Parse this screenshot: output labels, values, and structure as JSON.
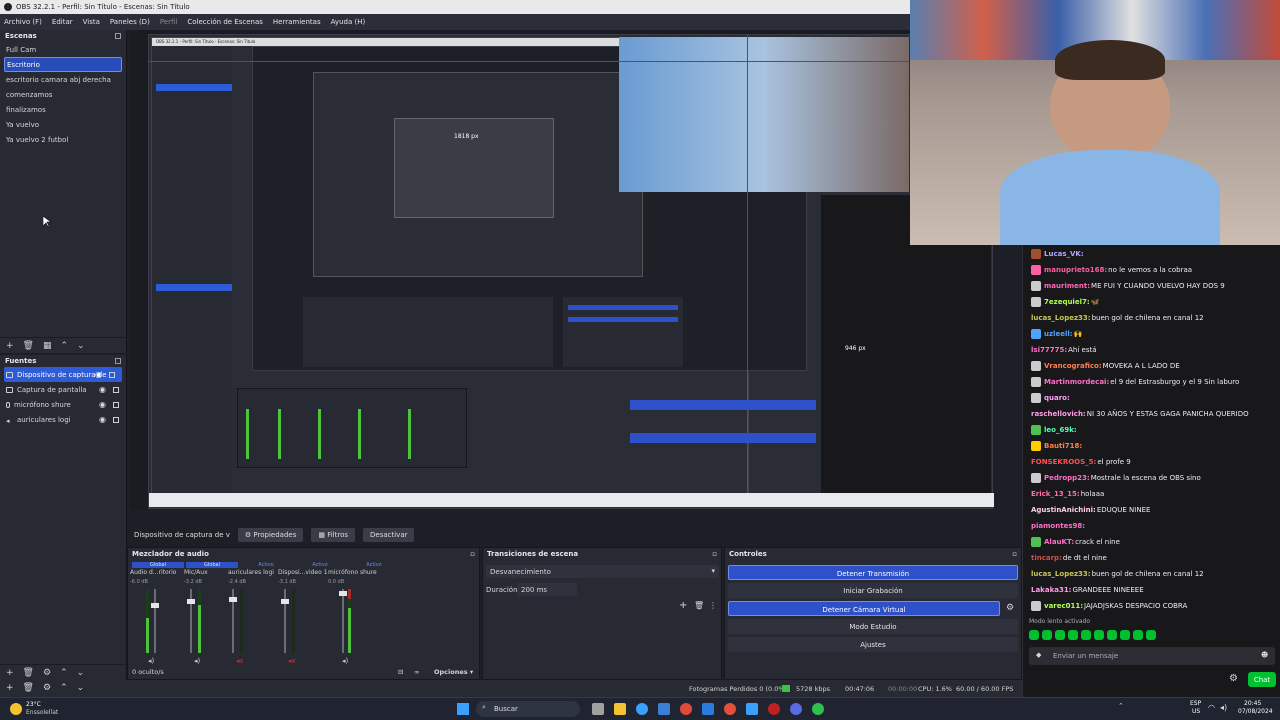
{
  "window": {
    "title": "OBS 32.2.1 - Perfil: Sin Título - Escenas: Sin Título"
  },
  "menu": [
    "Archivo (F)",
    "Editar",
    "Vista",
    "Paneles (D)",
    "Perfil",
    "Colección de Escenas",
    "Herramientas",
    "Ayuda (H)"
  ],
  "scenes": {
    "header": "Escenas",
    "items": [
      "Full Cam",
      "Escritorio",
      "escritorio camara abj derecha",
      "comenzamos",
      "finalizamos",
      "Ya vuelvo",
      "Ya vuelvo 2 futbol"
    ],
    "selected_index": 1
  },
  "sources": {
    "header": "Fuentes",
    "items": [
      "Dispositivo de captura de",
      "Captura de pantalla",
      "micrófono shure",
      "auriculares logi"
    ],
    "selected_index": 0
  },
  "nested": {
    "title": "OBS 32.2.1 - Perfil: Sin Título - Escenas: Sin Título",
    "px_label": "1818 px",
    "px_label2": "946 px"
  },
  "propbar": {
    "source": "Dispositivo de captura de v",
    "properties": "Propiedades",
    "filters": "Filtros",
    "deactivate": "Desactivar"
  },
  "mixer": {
    "title": "Mezclador de audio",
    "tab_global": "Global",
    "channels": [
      {
        "name": "Audio d...ritorio",
        "db": "-6.0 dB",
        "level": 0.55
      },
      {
        "name": "Mic/Aux",
        "db": "-3.2 dB",
        "level": 0.75
      },
      {
        "name": "auriculares logi",
        "db": "-2.4 dB",
        "level": 0.0
      },
      {
        "name": "Disposi...video 1",
        "db": "-3.1 dB",
        "level": 0.0
      },
      {
        "name": "micrófono shure",
        "db": "0.0 dB",
        "level": 0.7
      }
    ],
    "active_label": "Activo"
  },
  "transitions": {
    "title": "Transiciones de escena",
    "selected": "Desvanecimiento",
    "duration_label": "Duración",
    "duration": "200 ms"
  },
  "controls": {
    "title": "Controles",
    "stop_stream": "Detener Transmisión",
    "start_rec": "Iniciar Grabación",
    "stop_vcam": "Detener Cámara Virtual",
    "studio": "Modo Estudio",
    "settings": "Ajustes"
  },
  "status": {
    "hidden": "0 oculto/s",
    "options": "Opciones",
    "dropped": "Fotogramas Perdidos 0 (0.0%)",
    "kbps": "5728 kbps",
    "time1": "00:47:06",
    "time2": "00:00:00",
    "cpu": "CPU: 1.6%",
    "fps": "60.00 / 60.00 FPS"
  },
  "chat": {
    "messages": [
      {
        "user": "Lucas_VK:",
        "text": "",
        "color": "#b2a7ff",
        "badge": "#a05030"
      },
      {
        "user": "manuprieto168:",
        "text": " no le vemos a la cobraa",
        "color": "#ff5fa0",
        "badge": "#ff5fa0"
      },
      {
        "user": "mauriment:",
        "text": " ME FUI Y CUANDO VUELVO HAY DOS 9",
        "color": "#ff69b4",
        "badge": "#cccccc"
      },
      {
        "user": "7ezequiel7:",
        "text": " 🦋",
        "color": "#b0ff50",
        "badge": "#cccccc"
      },
      {
        "user": "lucas_Lopez33:",
        "text": " buen gol de chilena en canal 12",
        "color": "#c8c850",
        "badge": ""
      },
      {
        "user": "uzleell:",
        "text": " 🙌",
        "color": "#4fa3ff",
        "badge": "#4fa3ff"
      },
      {
        "user": "lsi77775:",
        "text": " Ahí está",
        "color": "#ff6fc8",
        "badge": ""
      },
      {
        "user": "Vrancografico:",
        "text": " MOVEKA A L LADO DE",
        "color": "#ff7f50",
        "badge": "#cccccc"
      },
      {
        "user": "Martinmordecai:",
        "text": " el 9 del Estrasburgo y el 9 Sin laburo",
        "color": "#ff6fc8",
        "badge": "#cccccc"
      },
      {
        "user": "quaro:",
        "text": "",
        "color": "#ffa0ff",
        "badge": "#cccccc"
      },
      {
        "user": "raschellovich:",
        "text": " NI 30 AÑOS Y ESTAS GAGA PANICHA QUERIDO",
        "color": "#ff9fe8",
        "badge": ""
      },
      {
        "user": "leo_69k:",
        "text": "",
        "color": "#50ffb0",
        "badge": "#50c050"
      },
      {
        "user": "Bauti718:",
        "text": "",
        "color": "#ff7f50",
        "badge": "#ffcc00"
      },
      {
        "user": "FONSEKROOS_5:",
        "text": " el profe 9",
        "color": "#ff5050",
        "badge": ""
      },
      {
        "user": "Pedropp23:",
        "text": " Mostrale la escena de OBS sino",
        "color": "#ff6fc8",
        "badge": "#cccccc"
      },
      {
        "user": "Erick_13_15:",
        "text": " holaaa",
        "color": "#ff6fa8",
        "badge": ""
      },
      {
        "user": "AgustinAnichini:",
        "text": " EDUQUE NINEE",
        "color": "#ffd0e0",
        "badge": ""
      },
      {
        "user": "piamontes98:",
        "text": "",
        "color": "#ff6fc8",
        "badge": ""
      },
      {
        "user": "AlauKT:",
        "text": " crack el nine",
        "color": "#ff6fc8",
        "badge": "#50c050"
      },
      {
        "user": "tincarp:",
        "text": " de dt el nine",
        "color": "#c85050",
        "badge": ""
      },
      {
        "user": "lucas_Lopez33:",
        "text": " buen gol de chilena en canal 12",
        "color": "#c8c850",
        "badge": ""
      },
      {
        "user": "Lakaka31:",
        "text": " GRANDEEE NINEEEE",
        "color": "#ff9fe8",
        "badge": ""
      },
      {
        "user": "varec011:",
        "text": " JAJADJSKAS DESPACIO COBRA",
        "color": "#b0ff50",
        "badge": "#cccccc"
      }
    ],
    "slow_mode": "Modo lento activado",
    "input_placeholder": "Enviar un mensaje",
    "chat_button": "Chat"
  },
  "taskbar": {
    "weather_temp": "23°C",
    "weather_desc": "Enssolellat",
    "search": "Buscar",
    "lang1": "ESP",
    "lang2": "US",
    "time": "20:45",
    "date": "07/08/2024"
  },
  "colors": {
    "accent": "#2e50c8",
    "twitch_green": "#00c030"
  }
}
